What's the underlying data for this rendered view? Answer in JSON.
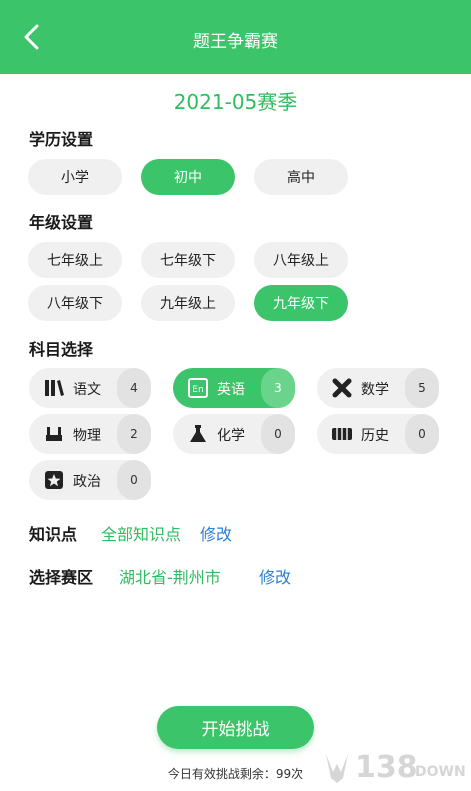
{
  "header": {
    "title": "题王争霸赛"
  },
  "season": "2021-05赛季",
  "education": {
    "label": "学历设置",
    "options": [
      "小学",
      "初中",
      "高中"
    ],
    "selected": "初中"
  },
  "grade": {
    "label": "年级设置",
    "options": [
      "七年级上",
      "七年级下",
      "八年级上",
      "八年级下",
      "九年级上",
      "九年级下"
    ],
    "selected": "九年级下"
  },
  "subject": {
    "label": "科目选择",
    "items": [
      {
        "name": "语文",
        "count": "4",
        "icon": "books-icon"
      },
      {
        "name": "英语",
        "count": "3",
        "icon": "english-en-icon"
      },
      {
        "name": "数学",
        "count": "5",
        "icon": "math-cross-icon"
      },
      {
        "name": "物理",
        "count": "2",
        "icon": "physics-magnet-icon"
      },
      {
        "name": "化学",
        "count": "0",
        "icon": "chemistry-flask-icon"
      },
      {
        "name": "历史",
        "count": "0",
        "icon": "history-scroll-icon"
      },
      {
        "name": "政治",
        "count": "0",
        "icon": "politics-star-icon"
      }
    ],
    "selected": "英语"
  },
  "knowledge": {
    "label": "知识点",
    "value": "全部知识点",
    "edit": "修改"
  },
  "region": {
    "label": "选择赛区",
    "value": "湖北省-荆州市",
    "edit": "修改"
  },
  "start_button": "开始挑战",
  "remaining": "今日有效挑战剩余：99次",
  "watermark": {
    "number": "138",
    "suffix": "DOWN"
  },
  "colors": {
    "accent": "#3cc46a",
    "accent_text": "#2ebd5f",
    "link": "#2a7fd6",
    "pill_bg": "#f0f0f0"
  }
}
